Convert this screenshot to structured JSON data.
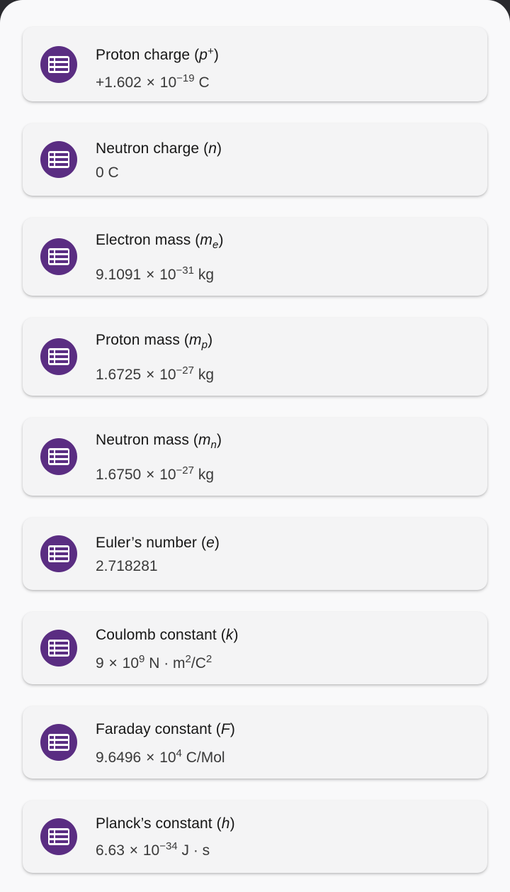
{
  "constants": [
    {
      "name": "Proton charge",
      "symbol": "p",
      "symbol_sup": "+",
      "symbol_sub": "",
      "mantissa": "+1.602",
      "times": "×",
      "base": "10",
      "exponent": "−19",
      "unit": "C",
      "unit_sup": "",
      "unit_tail": "",
      "unit_tail_sup": "",
      "icon": "list-icon"
    },
    {
      "name": "Neutron charge",
      "symbol": "n",
      "symbol_sup": "",
      "symbol_sub": "",
      "mantissa": "0",
      "times": "",
      "base": "",
      "exponent": "",
      "unit": "C",
      "unit_sup": "",
      "unit_tail": "",
      "unit_tail_sup": "",
      "icon": "list-icon"
    },
    {
      "name": "Electron mass",
      "symbol": "m",
      "symbol_sup": "",
      "symbol_sub": "e",
      "mantissa": "9.1091",
      "times": "×",
      "base": "10",
      "exponent": "−31",
      "unit": "kg",
      "unit_sup": "",
      "unit_tail": "",
      "unit_tail_sup": "",
      "icon": "list-icon"
    },
    {
      "name": "Proton mass",
      "symbol": "m",
      "symbol_sup": "",
      "symbol_sub": "p",
      "mantissa": "1.6725",
      "times": "×",
      "base": "10",
      "exponent": "−27",
      "unit": "kg",
      "unit_sup": "",
      "unit_tail": "",
      "unit_tail_sup": "",
      "icon": "list-icon"
    },
    {
      "name": "Neutron mass",
      "symbol": "m",
      "symbol_sup": "",
      "symbol_sub": "n",
      "mantissa": "1.6750",
      "times": "×",
      "base": "10",
      "exponent": "−27",
      "unit": "kg",
      "unit_sup": "",
      "unit_tail": "",
      "unit_tail_sup": "",
      "icon": "list-icon"
    },
    {
      "name": "Euler’s number",
      "symbol": "e",
      "symbol_sup": "",
      "symbol_sub": "",
      "mantissa": "2.718281",
      "times": "",
      "base": "",
      "exponent": "",
      "unit": "",
      "unit_sup": "",
      "unit_tail": "",
      "unit_tail_sup": "",
      "icon": "list-icon"
    },
    {
      "name": "Coulomb constant",
      "symbol": "k",
      "symbol_sup": "",
      "symbol_sub": "",
      "mantissa": "9",
      "times": "×",
      "base": "10",
      "exponent": "9",
      "unit": "N · m",
      "unit_sup": "2",
      "unit_tail": "/C",
      "unit_tail_sup": "2",
      "icon": "list-icon"
    },
    {
      "name": "Faraday constant",
      "symbol": "F",
      "symbol_sup": "",
      "symbol_sub": "",
      "mantissa": "9.6496",
      "times": "×",
      "base": "10",
      "exponent": "4",
      "unit": "C/Mol",
      "unit_sup": "",
      "unit_tail": "",
      "unit_tail_sup": "",
      "icon": "list-icon"
    },
    {
      "name": "Planck’s constant",
      "symbol": "h",
      "symbol_sup": "",
      "symbol_sub": "",
      "mantissa": "6.63",
      "times": "×",
      "base": "10",
      "exponent": "−34",
      "unit": "J · s",
      "unit_sup": "",
      "unit_tail": "",
      "unit_tail_sup": "",
      "icon": "list-icon"
    }
  ],
  "colors": {
    "icon_bg": "#5a2d82",
    "card_bg": "#f4f4f5",
    "sheet_bg": "#f9f9fa"
  }
}
